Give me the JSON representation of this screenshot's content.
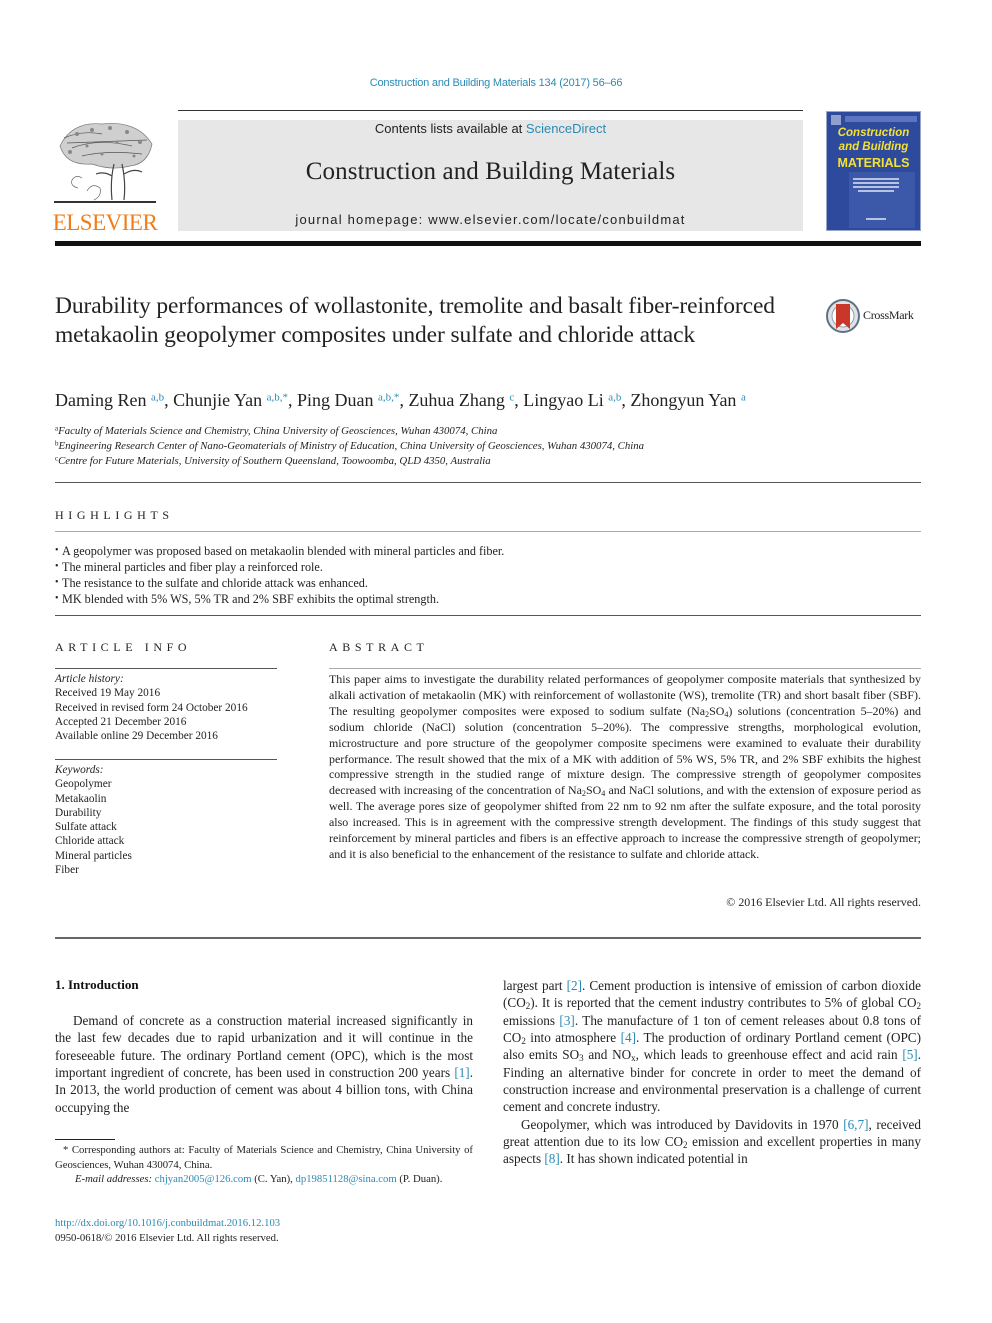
{
  "header": {
    "journal_reference": "Construction and Building Materials 134 (2017) 56–66",
    "contents_prefix": "Contents lists available at ",
    "contents_link": "ScienceDirect",
    "journal_title": "Construction and Building Materials",
    "homepage_text": "journal homepage: www.elsevier.com/locate/conbuildmat",
    "publisher_logo_text": "ELSEVIER",
    "cover": {
      "line1": "Construction",
      "line2": "and Building",
      "line3": "MATERIALS",
      "background_color": "#2e4a9c",
      "title_color": "#f4e136"
    },
    "accent_color": "#2a8ab6",
    "logo_color": "#f07d1a"
  },
  "article": {
    "title": "Durability performances of wollastonite, tremolite and basalt fiber-reinforced metakaolin geopolymer composites under sulfate and chloride attack",
    "crossmark_label": "CrossMark",
    "authors": [
      {
        "name": "Daming Ren",
        "sup": "a,b",
        "sep": ", "
      },
      {
        "name": "Chunjie Yan",
        "sup": "a,b,*",
        "sep": ", "
      },
      {
        "name": "Ping Duan",
        "sup": "a,b,*",
        "sep": ", "
      },
      {
        "name": "Zuhua Zhang",
        "sup": "c",
        "sep": ", "
      },
      {
        "name": "Lingyao Li",
        "sup": "a,b",
        "sep": ", "
      },
      {
        "name": "Zhongyun Yan",
        "sup": "a",
        "sep": ""
      }
    ],
    "affiliations": [
      {
        "mark": "a",
        "text": "Faculty of Materials Science and Chemistry, China University of Geosciences, Wuhan 430074, China"
      },
      {
        "mark": "b",
        "text": "Engineering Research Center of Nano-Geomaterials of Ministry of Education, China University of Geosciences, Wuhan 430074, China"
      },
      {
        "mark": "c",
        "text": "Centre for Future Materials, University of Southern Queensland, Toowoomba, QLD 4350, Australia"
      }
    ]
  },
  "highlights": {
    "heading": "HIGHLIGHTS",
    "items": [
      "A geopolymer was proposed based on metakaolin blended with mineral particles and fiber.",
      "The mineral particles and fiber play a reinforced role.",
      "The resistance to the sulfate and chloride attack was enhanced.",
      "MK blended with 5% WS, 5% TR and 2% SBF exhibits the optimal strength."
    ]
  },
  "article_info": {
    "heading": "ARTICLE INFO",
    "history_label": "Article history:",
    "history": [
      "Received 19 May 2016",
      "Received in revised form 24 October 2016",
      "Accepted 21 December 2016",
      "Available online 29 December 2016"
    ],
    "keywords_label": "Keywords:",
    "keywords": [
      "Geopolymer",
      "Metakaolin",
      "Durability",
      "Sulfate attack",
      "Chloride attack",
      "Mineral particles",
      "Fiber"
    ]
  },
  "abstract": {
    "heading": "ABSTRACT",
    "segments": [
      {
        "t": "This paper aims to investigate the durability related performances of geopolymer composite materials that synthesized by alkali activation of metakaolin (MK) with reinforcement of wollastonite (WS), tremo­lite (TR) and short basalt fiber (SBF). The resulting geopolymer composites were exposed to sodium sul­fate (Na"
      },
      {
        "sub": "2"
      },
      {
        "t": "SO"
      },
      {
        "sub": "4"
      },
      {
        "t": ") solutions (concentration 5–20%) and sodium chloride (NaCl) solution (concentration 5–20%). The compressive strengths, morphological evolution, microstructure and pore structure of the geopolymer composite specimens were examined to evaluate their durability performance. The result showed that the mix of a MK with addition of 5% WS, 5% TR, and 2% SBF exhibits the highest compressive strength in the studied range of mixture design. The compressive strength of geopolymer composites decreased with increasing of the concentration of Na"
      },
      {
        "sub": "2"
      },
      {
        "t": "SO"
      },
      {
        "sub": "4"
      },
      {
        "t": " and NaCl solutions, and with the extension of exposure period as well. The average pores size of geopolymer shifted from 22 nm to 92 nm after the sulfate exposure, and the total porosity also increased. This is in agreement with the compressive strength development. The findings of this study suggest that reinforcement by mineral particles and fibers is an effective approach to increase the compressive strength of geopolymer; and it is also benefi­cial to the enhancement of the resistance to sulfate and chloride attack."
      }
    ],
    "copyright": "© 2016 Elsevier Ltd. All rights reserved."
  },
  "introduction": {
    "heading": "1. Introduction",
    "left_paragraph": [
      {
        "t": "Demand of concrete as a construction material increased signif­icantly in the last few decades due to rapid urbanization and it will continue in the foreseeable future. The ordinary Portland cement (OPC), which is the most important ingredient of concrete, has been used in construction 200 years "
      },
      {
        "ref": "[1]"
      },
      {
        "t": ". In 2013, the world produc­tion of cement was about 4 billion tons, with China occupying the"
      }
    ],
    "right_paragraph_1": [
      {
        "t": "largest part "
      },
      {
        "ref": "[2]"
      },
      {
        "t": ". Cement production is intensive of emission of carbon dioxide (CO"
      },
      {
        "sub": "2"
      },
      {
        "t": "). It is reported that the cement industry contributes to 5% of global CO"
      },
      {
        "sub": "2"
      },
      {
        "t": " emissions "
      },
      {
        "ref": "[3]"
      },
      {
        "t": ". The manufacture of 1 ton of cement releases about 0.8 tons of CO"
      },
      {
        "sub": "2"
      },
      {
        "t": " into atmosphere "
      },
      {
        "ref": "[4]"
      },
      {
        "t": ". The production of ordinary Portland cement (OPC) also emits SO"
      },
      {
        "sub": "3"
      },
      {
        "t": " and NO"
      },
      {
        "sub": "x"
      },
      {
        "t": ", which leads to greenhouse effect and acid rain "
      },
      {
        "ref": "[5]"
      },
      {
        "t": ". Finding an alternative binder for concrete in order to meet the demand of construction increase and environmental preservation is a challenge of current cement and concrete industry."
      }
    ],
    "right_paragraph_2": [
      {
        "t": "Geopolymer, which was introduced by Davidovits in 1970 "
      },
      {
        "ref": "[6,7]"
      },
      {
        "t": ", received great attention due to its low CO"
      },
      {
        "sub": "2"
      },
      {
        "t": " emission and excellent properties in many aspects "
      },
      {
        "ref": "[8]"
      },
      {
        "t": ". It has shown indicated potential in"
      }
    ]
  },
  "footnotes": {
    "corresponding": "* Corresponding authors at: Faculty of Materials Science and Chemistry, China University of Geosciences, Wuhan 430074, China.",
    "email_label": "E-mail addresses:",
    "email_1": "chjyan2005@126.com",
    "email_1_owner": " (C. Yan), ",
    "email_2": "dp19851128@sina.com",
    "email_2_owner": " (P. Duan).",
    "doi": "http://dx.doi.org/10.1016/j.conbuildmat.2016.12.103",
    "issn_line": "0950-0618/© 2016 Elsevier Ltd. All rights reserved."
  }
}
